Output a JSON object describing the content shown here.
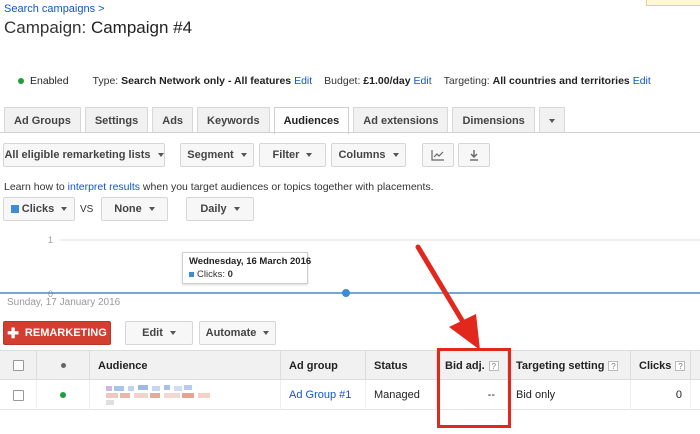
{
  "header": {
    "breadcrumb": "Search campaigns >",
    "title_prefix": "Campaign:",
    "title_name": "Campaign #4"
  },
  "infobar": {
    "status": "Enabled",
    "type_label": "Type:",
    "type_value": "Search Network only - All features",
    "budget_label": "Budget:",
    "budget_value": "£1.00/day",
    "targeting_label": "Targeting:",
    "targeting_value": "All countries and territories",
    "edit": "Edit"
  },
  "tabs": [
    {
      "label": "Ad Groups"
    },
    {
      "label": "Settings"
    },
    {
      "label": "Ads"
    },
    {
      "label": "Keywords"
    },
    {
      "label": "Audiences",
      "active": true
    },
    {
      "label": "Ad extensions"
    },
    {
      "label": "Dimensions"
    }
  ],
  "toolbar": {
    "filter_list": "All eligible remarketing lists",
    "segment": "Segment",
    "filter": "Filter",
    "columns": "Columns"
  },
  "learn": {
    "pre": "Learn how to ",
    "link": "interpret results",
    "post": " when you target audiences or topics together with placements."
  },
  "chart_controls": {
    "metric1": "Clicks",
    "vs": "VS",
    "metric2": "None",
    "period": "Daily"
  },
  "chart": {
    "y_top": "1",
    "y_bottom": "0",
    "start_date": "Sunday, 17 January 2016",
    "tooltip_date": "Wednesday, 16 March 2016",
    "tooltip_metric": "Clicks:",
    "tooltip_value": "0",
    "line_color": "#3c8dd4"
  },
  "actions": {
    "remarketing": "REMARKETING",
    "edit": "Edit",
    "automate": "Automate"
  },
  "table": {
    "headers": {
      "audience": "Audience",
      "ad_group": "Ad group",
      "status": "Status",
      "bid_adj": "Bid adj.",
      "targeting": "Targeting setting",
      "clicks": "Clicks",
      "help": "?"
    },
    "rows": [
      {
        "ad_group": "Ad Group #1",
        "status": "Managed",
        "bid_adj": "--",
        "targeting": "Bid only",
        "clicks": "0"
      }
    ]
  },
  "colors": {
    "accent_red": "#d23f31",
    "annotation_red": "#e2281d",
    "link_blue": "#1155cc",
    "enabled_green": "#1e9e3a"
  }
}
